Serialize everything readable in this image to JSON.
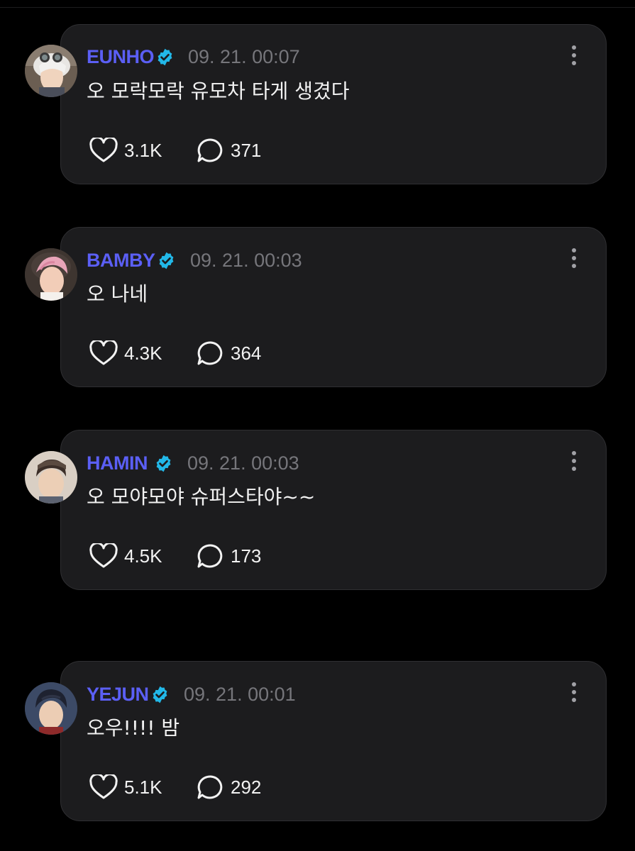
{
  "colors": {
    "background": "#000000",
    "card": "#1c1c1e",
    "username": "#5b5ff5",
    "verified_badge": "#22b8e8",
    "timestamp": "#76767b",
    "text": "#f2f2f2"
  },
  "icons": {
    "verified": "verified-badge-icon",
    "more": "more-vertical-icon",
    "like": "heart-icon",
    "reply": "comment-bubble-icon"
  },
  "posts": [
    {
      "username": "EUNHO",
      "timestamp": "09. 21. 00:07",
      "text": "오 모락모락 유모차 타게 생겼다",
      "likes": "3.1K",
      "replies": "371"
    },
    {
      "username": "BAMBY",
      "timestamp": "09. 21. 00:03",
      "text": "오 나네",
      "likes": "4.3K",
      "replies": "364"
    },
    {
      "username": "HAMIN",
      "timestamp": "09. 21. 00:03",
      "text": "오 모야모야 슈퍼스타야~~",
      "likes": "4.5K",
      "replies": "173"
    },
    {
      "username": "YEJUN",
      "timestamp": "09. 21. 00:01",
      "text": "오우!!!! 밤",
      "likes": "5.1K",
      "replies": "292"
    }
  ]
}
